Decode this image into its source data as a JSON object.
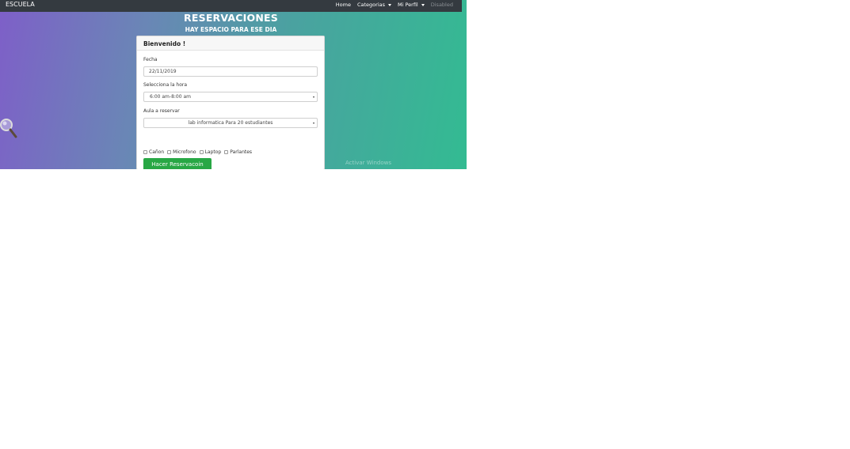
{
  "navbar": {
    "brand": "ESCUELA",
    "items": [
      {
        "label": "Home",
        "dropdown": false,
        "disabled": false
      },
      {
        "label": "Categorias",
        "dropdown": true,
        "disabled": false
      },
      {
        "label": "Mi Perfil",
        "dropdown": true,
        "disabled": false
      },
      {
        "label": "Disabled",
        "dropdown": false,
        "disabled": true
      }
    ]
  },
  "hero": {
    "title": "RESERVACIONES",
    "subtitle": "HAY ESPACIO PARA ESE DIA"
  },
  "card": {
    "header": "Bienvenido !",
    "date_label": "Fecha",
    "date_value": "22/11/2019",
    "time_label": "Selecciona la hora",
    "time_value": "6:00 am-8:00 am",
    "room_label": "Aula a reservar",
    "room_value": "lab informatica Para 20 estudiantes",
    "checkboxes": [
      "Cañon",
      "Microfono",
      "Laptop",
      "Parlantes"
    ],
    "submit_label": "Hacer Reservacoin"
  },
  "watermark": "Activar Windows",
  "icons": {
    "magnifier": "magnifier-icon",
    "caret": "caret-down-icon"
  }
}
